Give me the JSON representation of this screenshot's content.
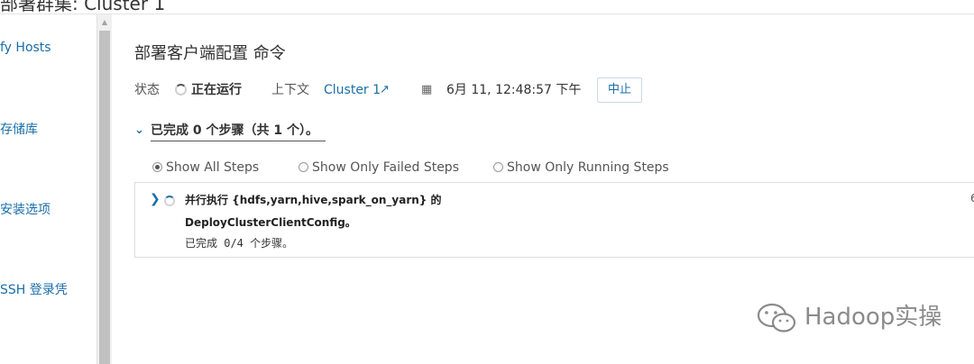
{
  "header": {
    "title_partial": "部署群集: Cluster 1"
  },
  "sidebar": {
    "items": [
      {
        "label": "fy Hosts"
      },
      {
        "label": "存储库"
      },
      {
        "label": "安装选项"
      },
      {
        "label": "SSH 登录凭"
      }
    ]
  },
  "command": {
    "title": "部署客户端配置 命令",
    "status_label": "状态",
    "status_value": "正在运行",
    "context_label": "上下文",
    "context_link": "Cluster 1",
    "timestamp": "6月 11, 12:48:57 下午",
    "abort_label": "中止"
  },
  "summary": {
    "text": "已完成 0 个步骤（共 1 个）。"
  },
  "filters": {
    "options": [
      {
        "label": "Show All Steps",
        "checked": true
      },
      {
        "label": "Show Only Failed Steps",
        "checked": false
      },
      {
        "label": "Show Only Running Steps",
        "checked": false
      }
    ]
  },
  "step": {
    "line1": "并行执行 {hdfs,yarn,hive,spark_on_yarn} 的",
    "line2": "DeployClusterClientConfig。",
    "progress": "已完成 0/4 个步骤。",
    "trailing": "6"
  },
  "watermark": {
    "text": "Hadoop实操"
  }
}
